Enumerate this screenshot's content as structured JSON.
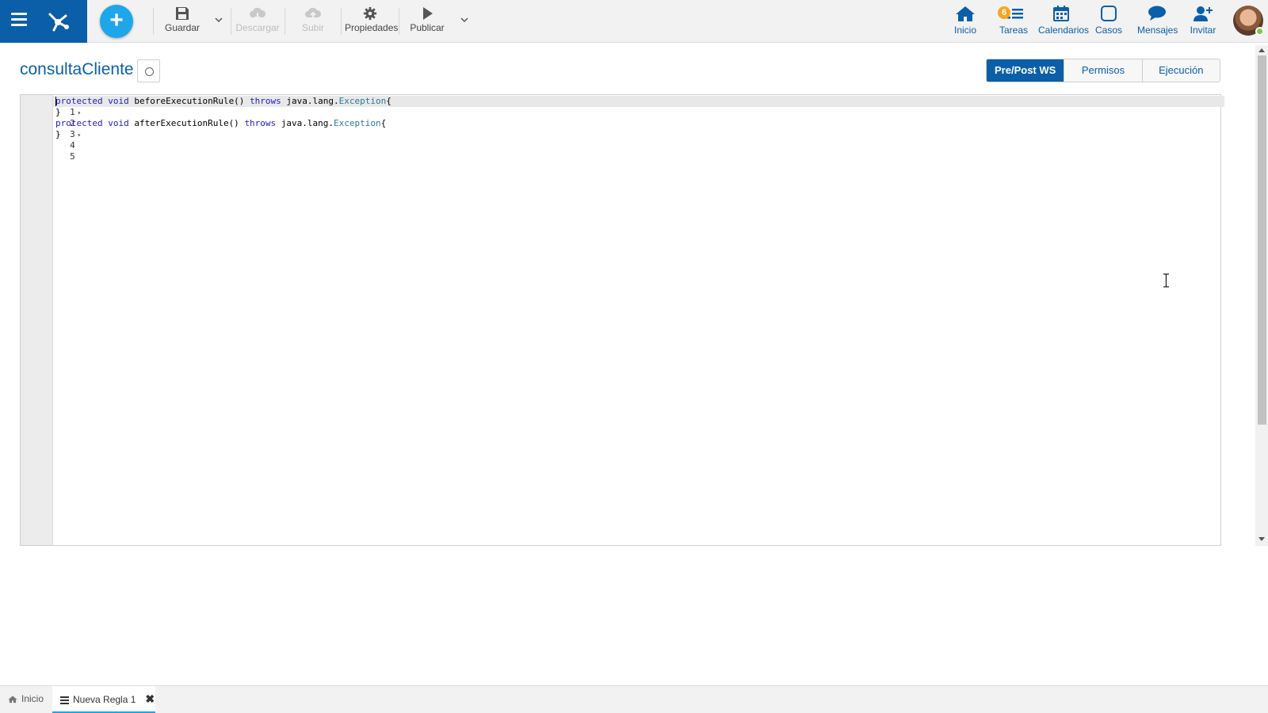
{
  "toolbar": {
    "items": [
      {
        "label": "Guardar",
        "icon": "save-icon",
        "enabled": true
      },
      {
        "label": "Descargar",
        "icon": "cloud-download-icon",
        "enabled": false
      },
      {
        "label": "Subir",
        "icon": "cloud-upload-icon",
        "enabled": false
      },
      {
        "label": "Propiedades",
        "icon": "gear-icon",
        "enabled": true
      },
      {
        "label": "Publicar",
        "icon": "play-icon",
        "enabled": true
      }
    ]
  },
  "nav": {
    "items": [
      {
        "label": "Inicio",
        "icon": "home-icon"
      },
      {
        "label": "Tareas",
        "icon": "tasks-icon",
        "badge": "6"
      },
      {
        "label": "Calendarios",
        "icon": "calendar-icon"
      },
      {
        "label": "Casos",
        "icon": "square-icon"
      },
      {
        "label": "Mensajes",
        "icon": "chat-icon"
      },
      {
        "label": "Invitar",
        "icon": "add-user-icon"
      }
    ]
  },
  "page": {
    "title": "consultaCliente"
  },
  "tabs": [
    {
      "label": "Pre/Post WS",
      "active": true
    },
    {
      "label": "Permisos",
      "active": false
    },
    {
      "label": "Ejecución",
      "active": false
    }
  ],
  "editor": {
    "lines": [
      {
        "number": "1",
        "foldable": true,
        "text": "protected void beforeExecutionRule() throws java.lang.Exception{"
      },
      {
        "number": "2",
        "foldable": false,
        "text": "}"
      },
      {
        "number": "3",
        "foldable": true,
        "text": "protected void afterExecutionRule() throws java.lang.Exception{"
      },
      {
        "number": "4",
        "foldable": false,
        "text": "}"
      },
      {
        "number": "5",
        "foldable": false,
        "text": ""
      }
    ]
  },
  "bottom_tabs": [
    {
      "label": "Inicio",
      "icon": "home-icon",
      "active": false
    },
    {
      "label": "Nueva Regla 1",
      "icon": "rule-icon",
      "active": true,
      "closable": true
    }
  ],
  "colors": {
    "brand": "#0b5fa8",
    "accent": "#1ea6ea",
    "badge": "#f5a623",
    "status_online": "#7ac943"
  }
}
